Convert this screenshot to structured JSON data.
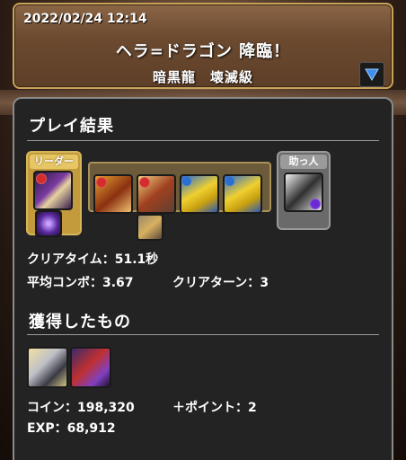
{
  "header": {
    "datetime": "2022/02/24 12:14",
    "dungeon_title": "ヘラ=ドラゴン 降臨！",
    "difficulty": "暗黒龍　壊滅級",
    "dropdown_icon": "triangle-down-icon"
  },
  "result": {
    "section_title": "プレイ結果",
    "leader_label": "リーダー",
    "helper_label": "助っ人",
    "clear_time_label": "クリアタイム：",
    "clear_time_value": "51.1秒",
    "avg_combo_label": "平均コンボ：",
    "avg_combo_value": "3.67",
    "clear_turns_label": "クリアターン：",
    "clear_turns_value": "3"
  },
  "rewards": {
    "section_title": "獲得したもの",
    "coin_label": "コイン：",
    "coin_value": "198,320",
    "plus_points_label": "＋ポイント：",
    "plus_points_value": "2",
    "exp_label": "EXP：",
    "exp_value": "68,912"
  },
  "colors": {
    "leader_frame": "#c39a3c",
    "helper_frame": "#6a6a6a",
    "panel_bg": "#232323",
    "banner_border": "#c9a35b"
  }
}
